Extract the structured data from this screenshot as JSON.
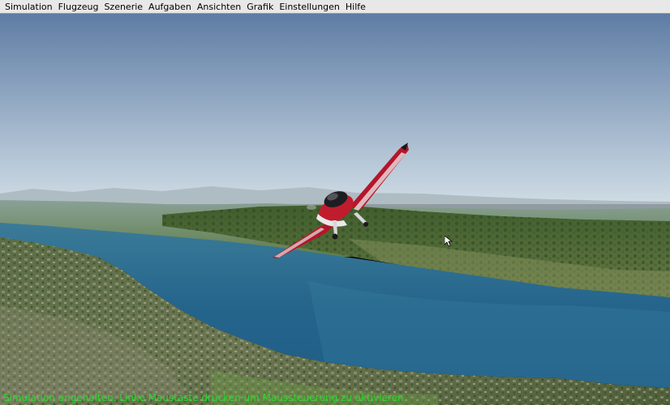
{
  "menubar": {
    "items": [
      {
        "label": "Simulation"
      },
      {
        "label": "Flugzeug"
      },
      {
        "label": "Szenerie"
      },
      {
        "label": "Aufgaben"
      },
      {
        "label": "Ansichten"
      },
      {
        "label": "Grafik"
      },
      {
        "label": "Einstellungen"
      },
      {
        "label": "Hilfe"
      }
    ]
  },
  "status": {
    "message": "Simulation angehalten. Linke Maustaste drücken um Maussteuerung zu aktivieren",
    "color": "#2bd82b"
  },
  "scene": {
    "sky_top": "#5f7ea6",
    "sky_horizon": "#c9d7e2",
    "lake": "#2a6e93",
    "aircraft_body": "#b3162a"
  }
}
